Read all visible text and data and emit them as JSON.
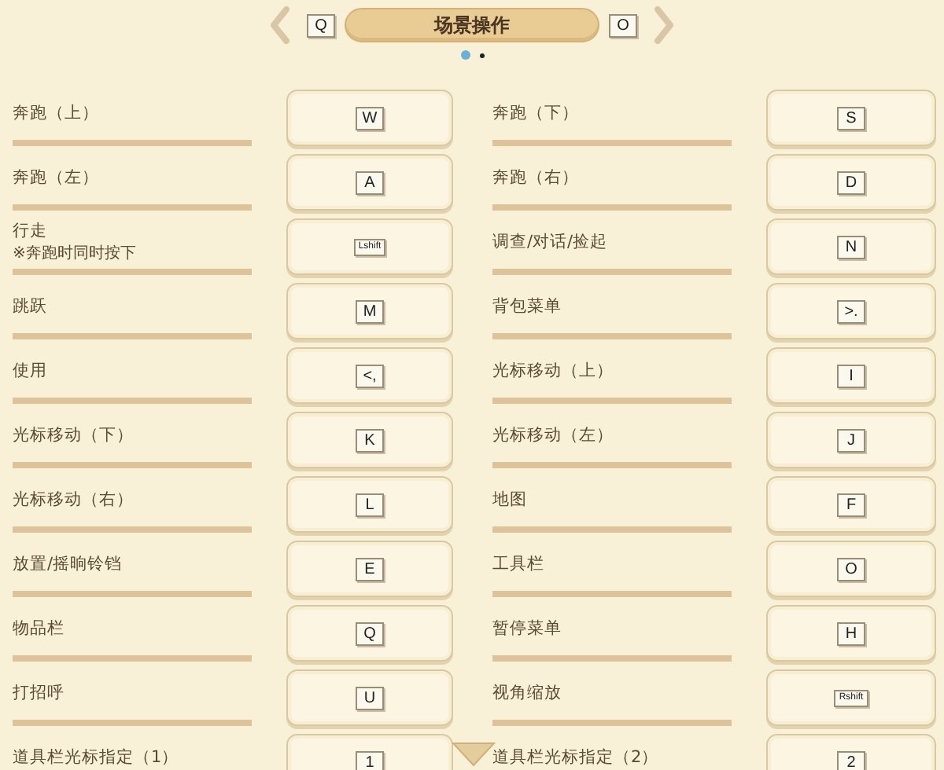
{
  "header": {
    "prev_key": "Q",
    "title": "场景操作",
    "next_key": "O"
  },
  "pages": [
    {
      "selected": true
    },
    {
      "selected": false
    }
  ],
  "bindings": [
    {
      "label": "奔跑（上）",
      "key": "W"
    },
    {
      "label": "奔跑（下）",
      "key": "S"
    },
    {
      "label": "奔跑（左）",
      "key": "A"
    },
    {
      "label": "奔跑（右）",
      "key": "D"
    },
    {
      "label": "行走",
      "note": "※奔跑时同时按下",
      "key": "Lshift"
    },
    {
      "label": "调查/对话/捡起",
      "key": "N"
    },
    {
      "label": "跳跃",
      "key": "M"
    },
    {
      "label": "背包菜单",
      "key": ">."
    },
    {
      "label": "使用",
      "key": "<,"
    },
    {
      "label": "光标移动（上）",
      "key": "I"
    },
    {
      "label": "光标移动（下）",
      "key": "K"
    },
    {
      "label": "光标移动（左）",
      "key": "J"
    },
    {
      "label": "光标移动（右）",
      "key": "L"
    },
    {
      "label": "地图",
      "key": "F"
    },
    {
      "label": "放置/摇晌铃铛",
      "key": "E"
    },
    {
      "label": "工具栏",
      "key": "O"
    },
    {
      "label": "物品栏",
      "key": "Q"
    },
    {
      "label": "暂停菜单",
      "key": "H"
    },
    {
      "label": "打招呼",
      "key": "U"
    },
    {
      "label": "视角缩放",
      "key": "Rshift"
    },
    {
      "label": "道具栏光标指定（1）",
      "key": "1"
    },
    {
      "label": "道具栏光标指定（2）",
      "key": "2"
    }
  ]
}
